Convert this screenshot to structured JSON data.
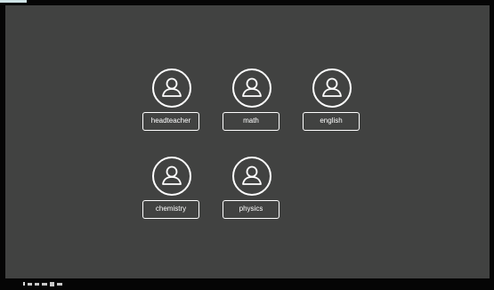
{
  "users": [
    {
      "name": "headteacher",
      "icon": "user-icon"
    },
    {
      "name": "math",
      "icon": "user-icon"
    },
    {
      "name": "english",
      "icon": "user-icon"
    },
    {
      "name": "chemistry",
      "icon": "user-icon"
    },
    {
      "name": "physics",
      "icon": "user-icon"
    }
  ],
  "colors": {
    "background": "#414241",
    "bezel": "#050505",
    "foreground": "#ffffff"
  }
}
